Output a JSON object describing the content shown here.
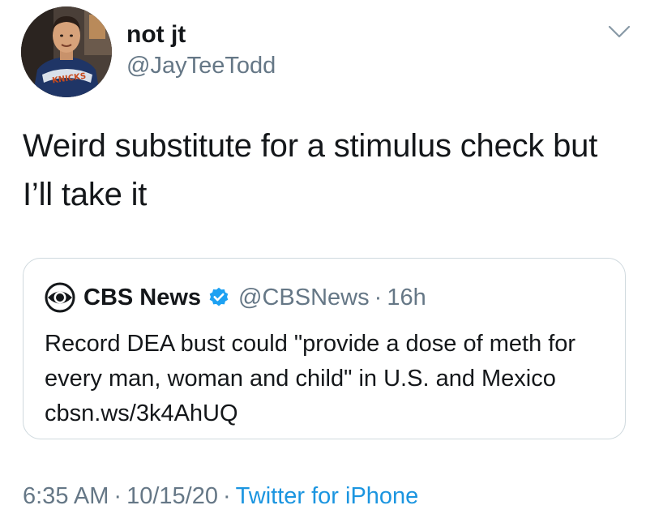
{
  "tweet": {
    "author": {
      "display_name": "not jt",
      "handle": "@JayTeeTodd",
      "avatar_icon": "profile-photo"
    },
    "menu_icon": "chevron-down-icon",
    "text": "Weird substitute for a stimulus check but I’ll take it",
    "quote": {
      "logo_icon": "cbs-eye-logo",
      "display_name": "CBS News",
      "verified": true,
      "verified_color": "#1da1f2",
      "handle": "@CBSNews",
      "separator": "·",
      "time": "16h",
      "text": "Record DEA bust could \"provide a dose of meth for every man, woman and child\" in U.S. and Mexico cbsn.ws/3k4AhUQ"
    },
    "meta": {
      "time": "6:35 AM",
      "date": "10/15/20",
      "separator": "·",
      "source": "Twitter for iPhone",
      "source_color": "#1b95e0"
    }
  }
}
